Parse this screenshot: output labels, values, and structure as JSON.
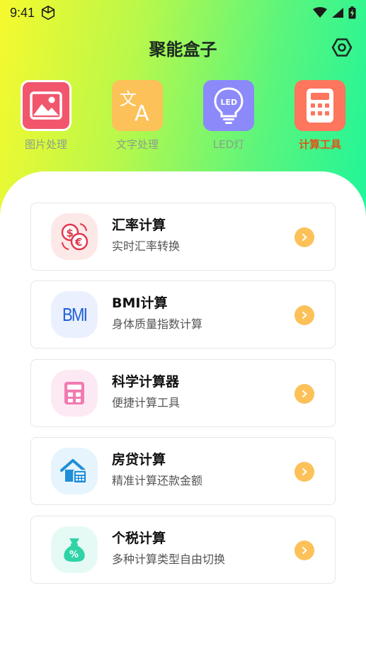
{
  "status_bar": {
    "time": "9:41"
  },
  "header": {
    "title": "聚能盒子"
  },
  "categories": [
    {
      "label": "图片处理",
      "icon": "image-icon",
      "color": "#f2566d"
    },
    {
      "label": "文字处理",
      "icon": "translate-icon",
      "color": "#fcc158"
    },
    {
      "label": "LED灯",
      "icon": "led-bulb-icon",
      "color": "#8c89fb"
    },
    {
      "label": "计算工具",
      "icon": "calculator-icon",
      "color": "#fd765d",
      "active": true
    }
  ],
  "tools": [
    {
      "title": "汇率计算",
      "subtitle": "实时汇率转换",
      "icon": "currency-exchange-icon",
      "bg": "#fde8e8"
    },
    {
      "title": "BMI计算",
      "subtitle": "身体质量指数计算",
      "icon": "bmi-icon",
      "icon_text": "BMI",
      "bg": "#eaf0fd"
    },
    {
      "title": "科学计算器",
      "subtitle": "便捷计算工具",
      "icon": "calculator-icon",
      "bg": "#fde9f3"
    },
    {
      "title": "房贷计算",
      "subtitle": "精准计算还款金额",
      "icon": "house-calculator-icon",
      "bg": "#e6f4fd"
    },
    {
      "title": "个税计算",
      "subtitle": "多种计算类型自由切换",
      "icon": "money-bag-icon",
      "bg": "#e6faf5"
    }
  ],
  "colors": {
    "accent": "#fcc158",
    "active_tab": "#e2531a",
    "inactive_tab": "#8aa08a"
  }
}
